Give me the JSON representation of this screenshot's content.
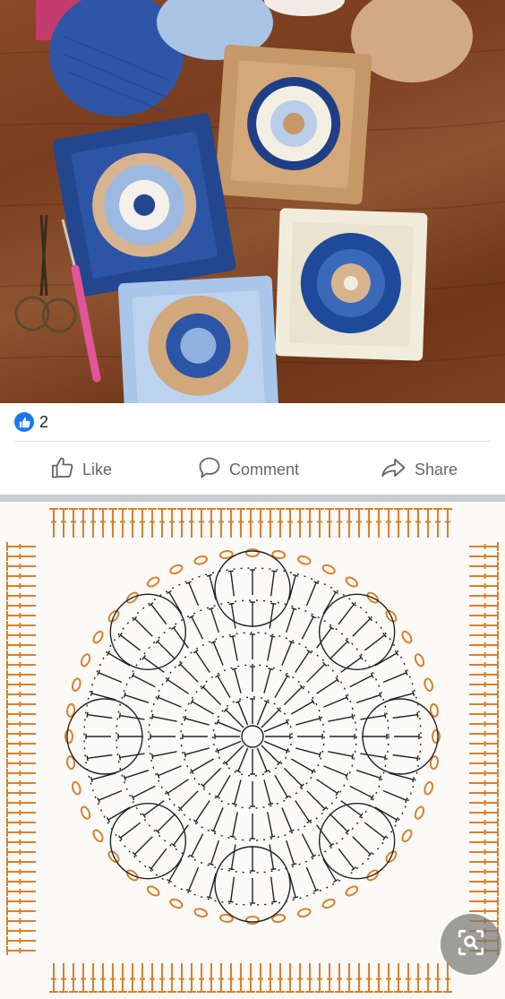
{
  "post": {
    "photo_alt": "Crochet granny squares with yarn and scissors",
    "reactions": {
      "icon": "thumbs-up-icon",
      "count": "2"
    },
    "actions": {
      "like_label": "Like",
      "comment_label": "Comment",
      "share_label": "Share"
    },
    "diagram_alt": "Crochet chart diagram for African flower square",
    "lens_icon": "visual-search-icon"
  },
  "colors": {
    "facebook_blue": "#1877f2",
    "action_gray": "#65676b",
    "diagram_orange": "#d9802a",
    "diagram_black": "#222222"
  }
}
